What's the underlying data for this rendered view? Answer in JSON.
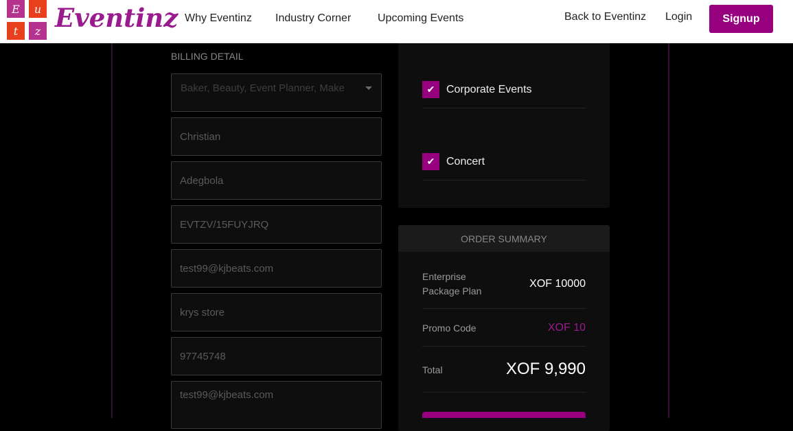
{
  "header": {
    "logo_letters": [
      "E",
      "u",
      "t",
      "z"
    ],
    "brand": "Eventinz",
    "nav": [
      "Why Eventinz",
      "Industry Corner",
      "Upcoming Events"
    ],
    "back_link": "Back to Eventinz",
    "login": "Login",
    "signup": "Signup",
    "colors": {
      "brand": "#9a1b8e",
      "accent": "#96007f",
      "tile_red": "#e8401c",
      "tile_purple": "#b5338f"
    }
  },
  "billing": {
    "title": "BILLING DETAIL",
    "category_placeholder": "Baker, Beauty, Event Planner, Make",
    "fields": [
      "Christian",
      "Adegbola",
      "EVTZV/15FUYJRQ",
      "test99@kjbeats.com",
      "krys store",
      "97745748",
      "test99@kjbeats.com"
    ]
  },
  "event_types": [
    {
      "label": "Corporate Events",
      "checked": true
    },
    {
      "label": "Concert",
      "checked": true
    }
  ],
  "order_summary": {
    "title": "ORDER SUMMARY",
    "plan_label_1": "Enterprise",
    "plan_label_2": "Package Plan",
    "plan_value": "XOF 10000",
    "promo_label": "Promo Code",
    "promo_value": "XOF 10",
    "total_label": "Total",
    "total_value": "XOF 9,990"
  }
}
